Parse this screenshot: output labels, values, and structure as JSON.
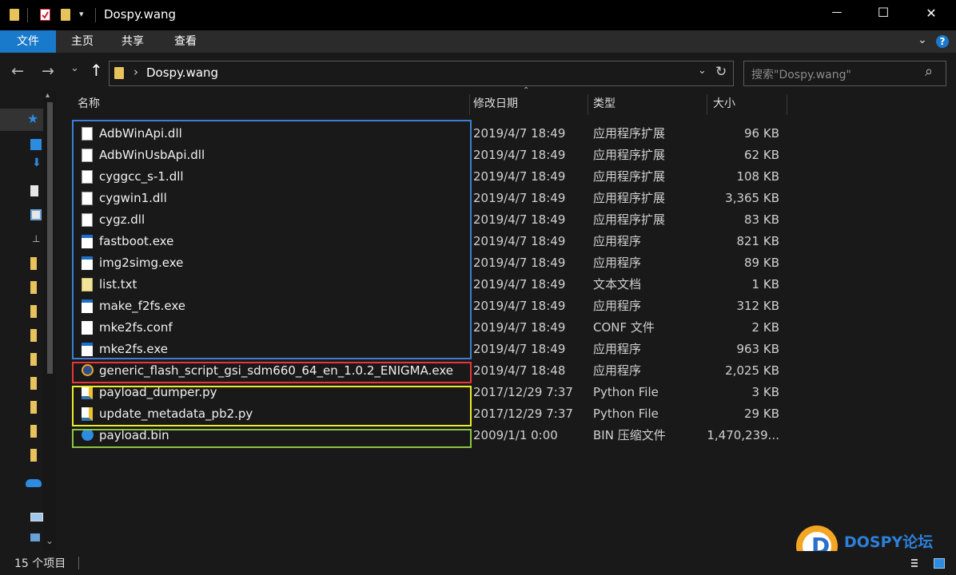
{
  "window": {
    "title": "Dospy.wang",
    "minimize_glyph": "—",
    "maximize_glyph": "☐",
    "close_glyph": "✕"
  },
  "ribbon": {
    "tabs": [
      {
        "label": "文件"
      },
      {
        "label": "主页"
      },
      {
        "label": "共享"
      },
      {
        "label": "查看"
      }
    ],
    "expand_glyph": "⌄",
    "help_glyph": "?"
  },
  "address": {
    "back_glyph": "←",
    "forward_glyph": "→",
    "recent_glyph": "⌄",
    "up_glyph": "↑",
    "breadcrumb_sep": "›",
    "path": "Dospy.wang",
    "dropdown_glyph": "⌄",
    "refresh_glyph": "↻",
    "search_placeholder": "搜索\"Dospy.wang\"",
    "search_glyph": "⌕"
  },
  "columns": {
    "name": "名称",
    "date": "修改日期",
    "type": "类型",
    "size": "大小"
  },
  "files": [
    {
      "name": "AdbWinApi.dll",
      "date": "2019/4/7 18:49",
      "type": "应用程序扩展",
      "size": "96 KB",
      "icon": "dll"
    },
    {
      "name": "AdbWinUsbApi.dll",
      "date": "2019/4/7 18:49",
      "type": "应用程序扩展",
      "size": "62 KB",
      "icon": "dll"
    },
    {
      "name": "cyggcc_s-1.dll",
      "date": "2019/4/7 18:49",
      "type": "应用程序扩展",
      "size": "108 KB",
      "icon": "dll"
    },
    {
      "name": "cygwin1.dll",
      "date": "2019/4/7 18:49",
      "type": "应用程序扩展",
      "size": "3,365 KB",
      "icon": "dll"
    },
    {
      "name": "cygz.dll",
      "date": "2019/4/7 18:49",
      "type": "应用程序扩展",
      "size": "83 KB",
      "icon": "dll"
    },
    {
      "name": "fastboot.exe",
      "date": "2019/4/7 18:49",
      "type": "应用程序",
      "size": "821 KB",
      "icon": "exe"
    },
    {
      "name": "img2simg.exe",
      "date": "2019/4/7 18:49",
      "type": "应用程序",
      "size": "89 KB",
      "icon": "exe"
    },
    {
      "name": "list.txt",
      "date": "2019/4/7 18:49",
      "type": "文本文档",
      "size": "1 KB",
      "icon": "txt"
    },
    {
      "name": "make_f2fs.exe",
      "date": "2019/4/7 18:49",
      "type": "应用程序",
      "size": "312 KB",
      "icon": "exe"
    },
    {
      "name": "mke2fs.conf",
      "date": "2019/4/7 18:49",
      "type": "CONF 文件",
      "size": "2 KB",
      "icon": "blank"
    },
    {
      "name": "mke2fs.exe",
      "date": "2019/4/7 18:49",
      "type": "应用程序",
      "size": "963 KB",
      "icon": "exe"
    },
    {
      "name": "generic_flash_script_gsi_sdm660_64_en_1.0.2_ENIGMA.exe",
      "date": "2019/4/7 18:48",
      "type": "应用程序",
      "size": "2,025 KB",
      "icon": "enigma"
    },
    {
      "name": "payload_dumper.py",
      "date": "2017/12/29 7:37",
      "type": "Python File",
      "size": "3 KB",
      "icon": "py"
    },
    {
      "name": "update_metadata_pb2.py",
      "date": "2017/12/29 7:37",
      "type": "Python File",
      "size": "29 KB",
      "icon": "py"
    },
    {
      "name": "payload.bin",
      "date": "2009/1/1 0:00",
      "type": "BIN 压缩文件",
      "size": "1,470,239...",
      "icon": "bin"
    }
  ],
  "status": {
    "count": "15 个项目"
  },
  "watermark": {
    "brand": "DOSPY论坛"
  },
  "highlight_colors": {
    "blue": "#3d7fd4",
    "red": "#e8343a",
    "yellow": "#ecec28",
    "green": "#8cc63f"
  }
}
